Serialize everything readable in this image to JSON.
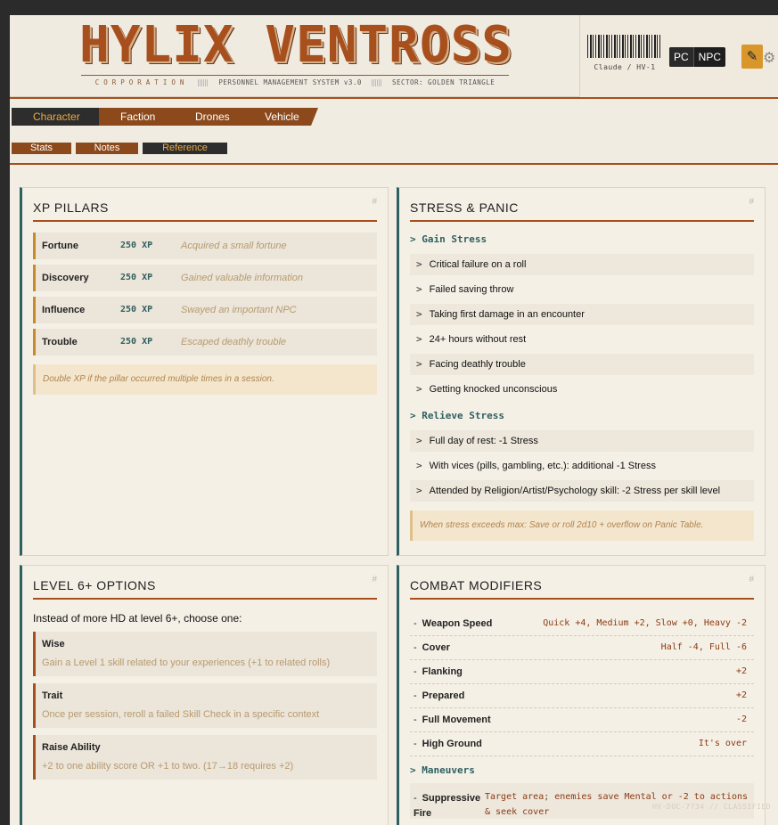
{
  "header": {
    "logo_title": "HYLIX VENTROSS",
    "corporation": "CORPORATION",
    "system": "PERSONNEL MANAGEMENT SYSTEM v3.0",
    "sector": "SECTOR: GOLDEN TRIANGLE",
    "barcode_label": "Claude / HV-1",
    "mode_pc": "PC",
    "mode_npc": "NPC",
    "edit_icon": "pencil-icon",
    "settings_icon": "gear-icon"
  },
  "tabs": [
    {
      "label": "Character",
      "active": true
    },
    {
      "label": "Faction"
    },
    {
      "label": "Drones"
    },
    {
      "label": "Vehicle"
    }
  ],
  "subtabs": [
    {
      "label": "Stats"
    },
    {
      "label": "Notes"
    },
    {
      "label": "Reference",
      "active": true
    }
  ],
  "xp": {
    "title": "XP PILLARS",
    "hash": "#",
    "rows": [
      {
        "name": "Fortune",
        "value": "250 XP",
        "desc": "Acquired a small fortune"
      },
      {
        "name": "Discovery",
        "value": "250 XP",
        "desc": "Gained valuable information"
      },
      {
        "name": "Influence",
        "value": "250 XP",
        "desc": "Swayed an important NPC"
      },
      {
        "name": "Trouble",
        "value": "250 XP",
        "desc": "Escaped deathly trouble"
      }
    ],
    "note": "Double XP if the pillar occurred multiple times in a session."
  },
  "stress": {
    "title": "STRESS & PANIC",
    "hash": "#",
    "gain_head": "> Gain Stress",
    "gain": [
      "Critical failure on a roll",
      "Failed saving throw",
      "Taking first damage in an encounter",
      "24+ hours without rest",
      "Facing deathly trouble",
      "Getting knocked unconscious"
    ],
    "relieve_head": "> Relieve Stress",
    "relieve": [
      "Full day of rest: -1 Stress",
      "With vices (pills, gambling, etc.): additional -1 Stress",
      "Attended by Religion/Artist/Psychology skill: -2 Stress per skill level"
    ],
    "note": "When stress exceeds max: Save or roll 2d10 + overflow on Panic Table."
  },
  "level": {
    "title": "LEVEL 6+ OPTIONS",
    "hash": "#",
    "intro": "Instead of more HD at level 6+, choose one:",
    "options": [
      {
        "name": "Wise",
        "desc": "Gain a Level 1 skill related to your experiences (+1 to related rolls)"
      },
      {
        "name": "Trait",
        "desc": "Once per session, reroll a failed Skill Check in a specific context"
      },
      {
        "name": "Raise Ability",
        "desc": "+2 to one ability score OR +1 to two. (17→18 requires +2)"
      }
    ]
  },
  "combat": {
    "title": "COMBAT MODIFIERS",
    "hash": "#",
    "rows": [
      {
        "name": "Weapon Speed",
        "value": "Quick +4, Medium +2, Slow +0, Heavy -2"
      },
      {
        "name": "Cover",
        "value": "Half -4, Full -6"
      },
      {
        "name": "Flanking",
        "value": "+2"
      },
      {
        "name": "Prepared",
        "value": "+2"
      },
      {
        "name": "Full Movement",
        "value": "-2"
      },
      {
        "name": "High Ground",
        "value": "It's over"
      }
    ],
    "maneuvers_head": "> Maneuvers",
    "maneuvers": [
      {
        "name_line1": "Suppressive",
        "name_line2": "Fire",
        "value_line1": "Target area; enemies save Mental or -2 to actions",
        "value_line2": "& seek cover"
      }
    ]
  },
  "footer_code": "HV-DOC-7734 // CLASSIFIED"
}
